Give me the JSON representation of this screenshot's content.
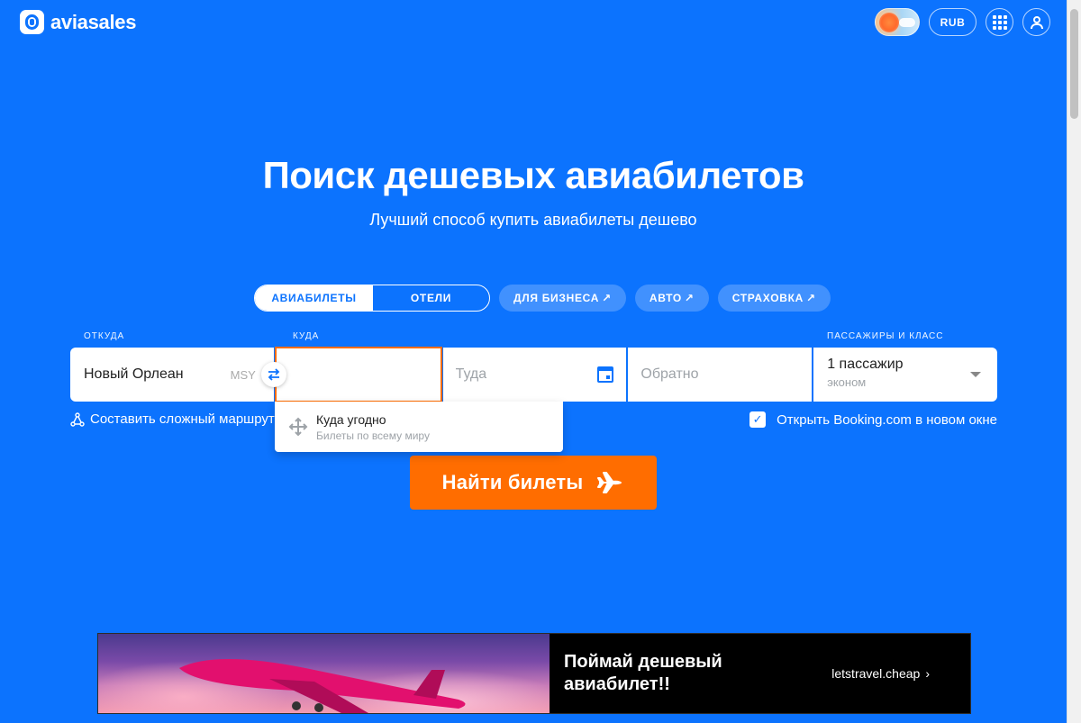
{
  "header": {
    "logo_text": "aviasales",
    "currency": "RUB"
  },
  "hero": {
    "title": "Поиск дешевых авиабилетов",
    "subtitle": "Лучший способ купить авиабилеты дешево"
  },
  "tabs": {
    "flights": "АВИАБИЛЕТЫ",
    "hotels": "ОТЕЛИ",
    "business": "ДЛЯ БИЗНЕСА",
    "auto": "АВТО",
    "insurance": "СТРАХОВКА",
    "external_arrow": "↗"
  },
  "form": {
    "origin_label": "ОТКУДА",
    "origin_city": "Новый Орлеан",
    "origin_iata": "MSY",
    "destination_label": "КУДА",
    "destination_value": "",
    "depart_placeholder": "Туда",
    "return_placeholder": "Обратно",
    "passengers_label": "ПАССАЖИРЫ И КЛАСС",
    "passengers_value": "1 пассажир",
    "class_value": "эконом"
  },
  "complex_route": "Составить сложный маршрут",
  "booking_checkbox": {
    "label": "Открыть Booking.com в новом окне",
    "checked": true
  },
  "dropdown": {
    "title": "Куда угодно",
    "subtitle": "Билеты по всему миру"
  },
  "search_button": "Найти билеты",
  "banner": {
    "title": "Поймай дешевый авиабилет!!",
    "link": "letstravel.cheap"
  },
  "colors": {
    "background": "#0c73fe",
    "accent": "#ff6d00"
  }
}
